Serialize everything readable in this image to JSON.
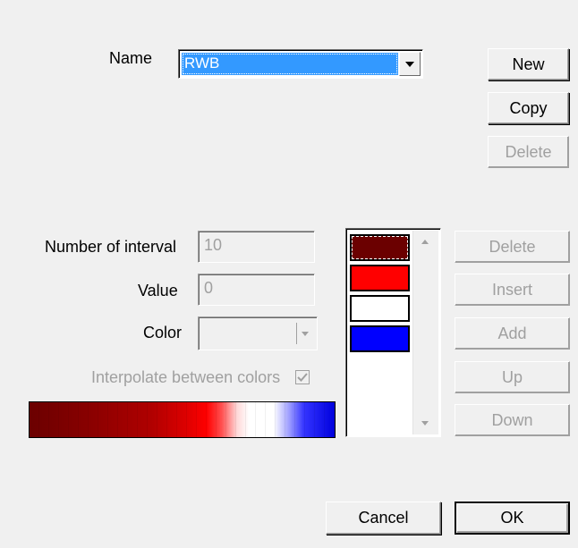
{
  "name": {
    "label": "Name",
    "value": "RWB"
  },
  "scheme_buttons": {
    "new": "New",
    "copy": "Copy",
    "delete": "Delete"
  },
  "fields": {
    "intervals_label": "Number of interval",
    "intervals_value": "10",
    "value_label": "Value",
    "value_value": "0",
    "color_label": "Color",
    "interpolate_label": "Interpolate between colors",
    "interpolate_checked": true
  },
  "color_list": [
    {
      "name": "dark-red",
      "color": "#6b0000"
    },
    {
      "name": "red",
      "color": "#ff0000"
    },
    {
      "name": "white",
      "color": "#ffffff"
    },
    {
      "name": "blue",
      "color": "#0000ff"
    }
  ],
  "list_buttons": {
    "delete": "Delete",
    "insert": "Insert",
    "add": "Add",
    "up": "Up",
    "down": "Down"
  },
  "dialog_buttons": {
    "cancel": "Cancel",
    "ok": "OK"
  }
}
